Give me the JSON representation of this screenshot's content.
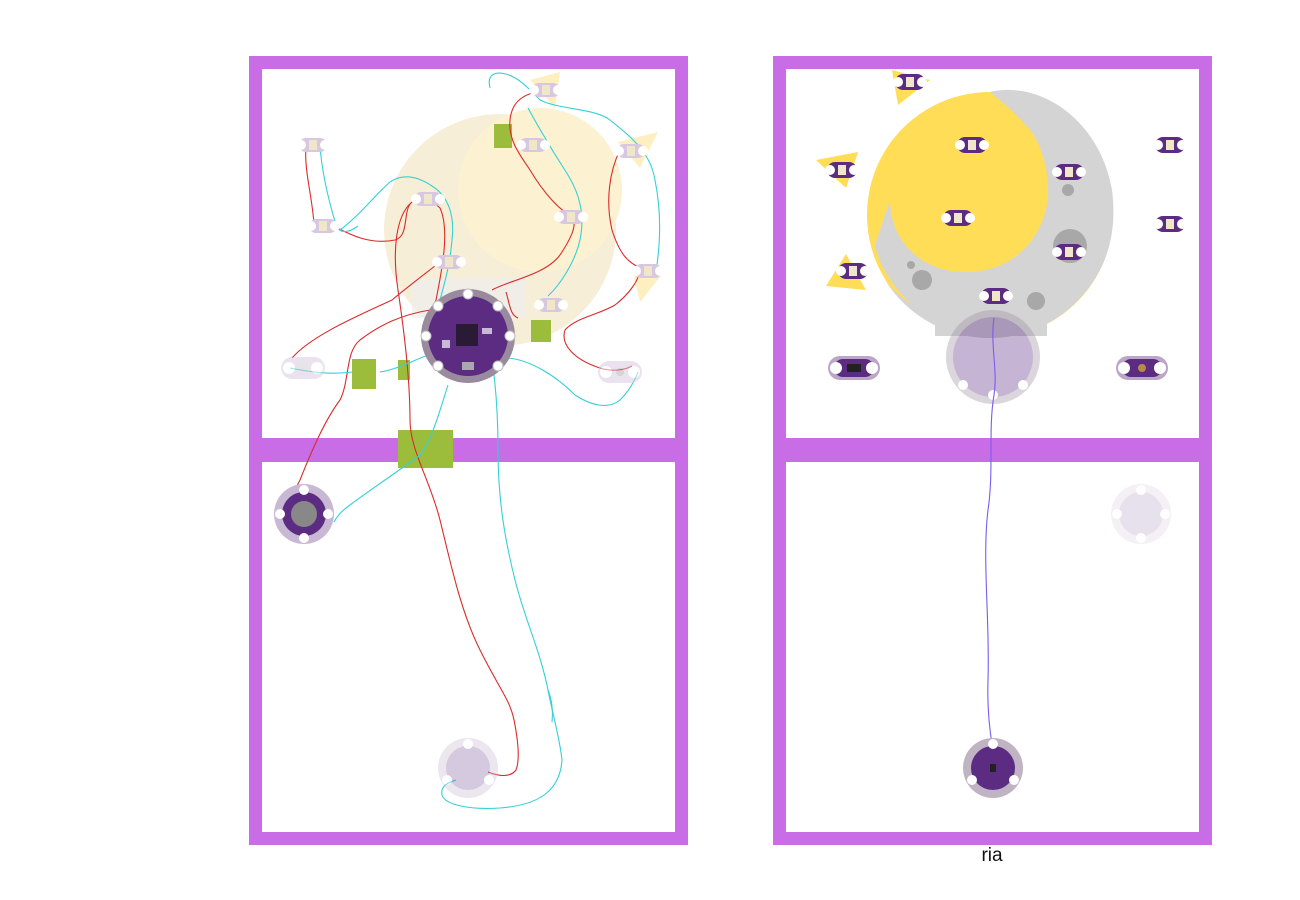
{
  "caption": "ria",
  "colors": {
    "frame": "#c86de6",
    "panel": "#ffffff",
    "board_purple": "#5b2c82",
    "moon_yellow": "#ffdd57",
    "moon_gray": "#d4d4d4",
    "thread_red": "#d92b2b",
    "thread_cyan": "#35d0d6",
    "thread_violet": "#7a5cf0",
    "patch_green": "#9cbd3c"
  },
  "left_diagram": {
    "name": "circuit-layout",
    "components": [
      "lilypad-main-board",
      "lilypad-led",
      "lilypad-buzzer",
      "lilypad-sensor",
      "lilypad-switch",
      "lilypad-button"
    ]
  },
  "right_diagram": {
    "name": "finished-layout",
    "components": [
      "moon-artwork",
      "lilypad-main-board",
      "lilypad-led",
      "lilypad-light-sensor",
      "lilypad-switch",
      "lilypad-button"
    ]
  }
}
